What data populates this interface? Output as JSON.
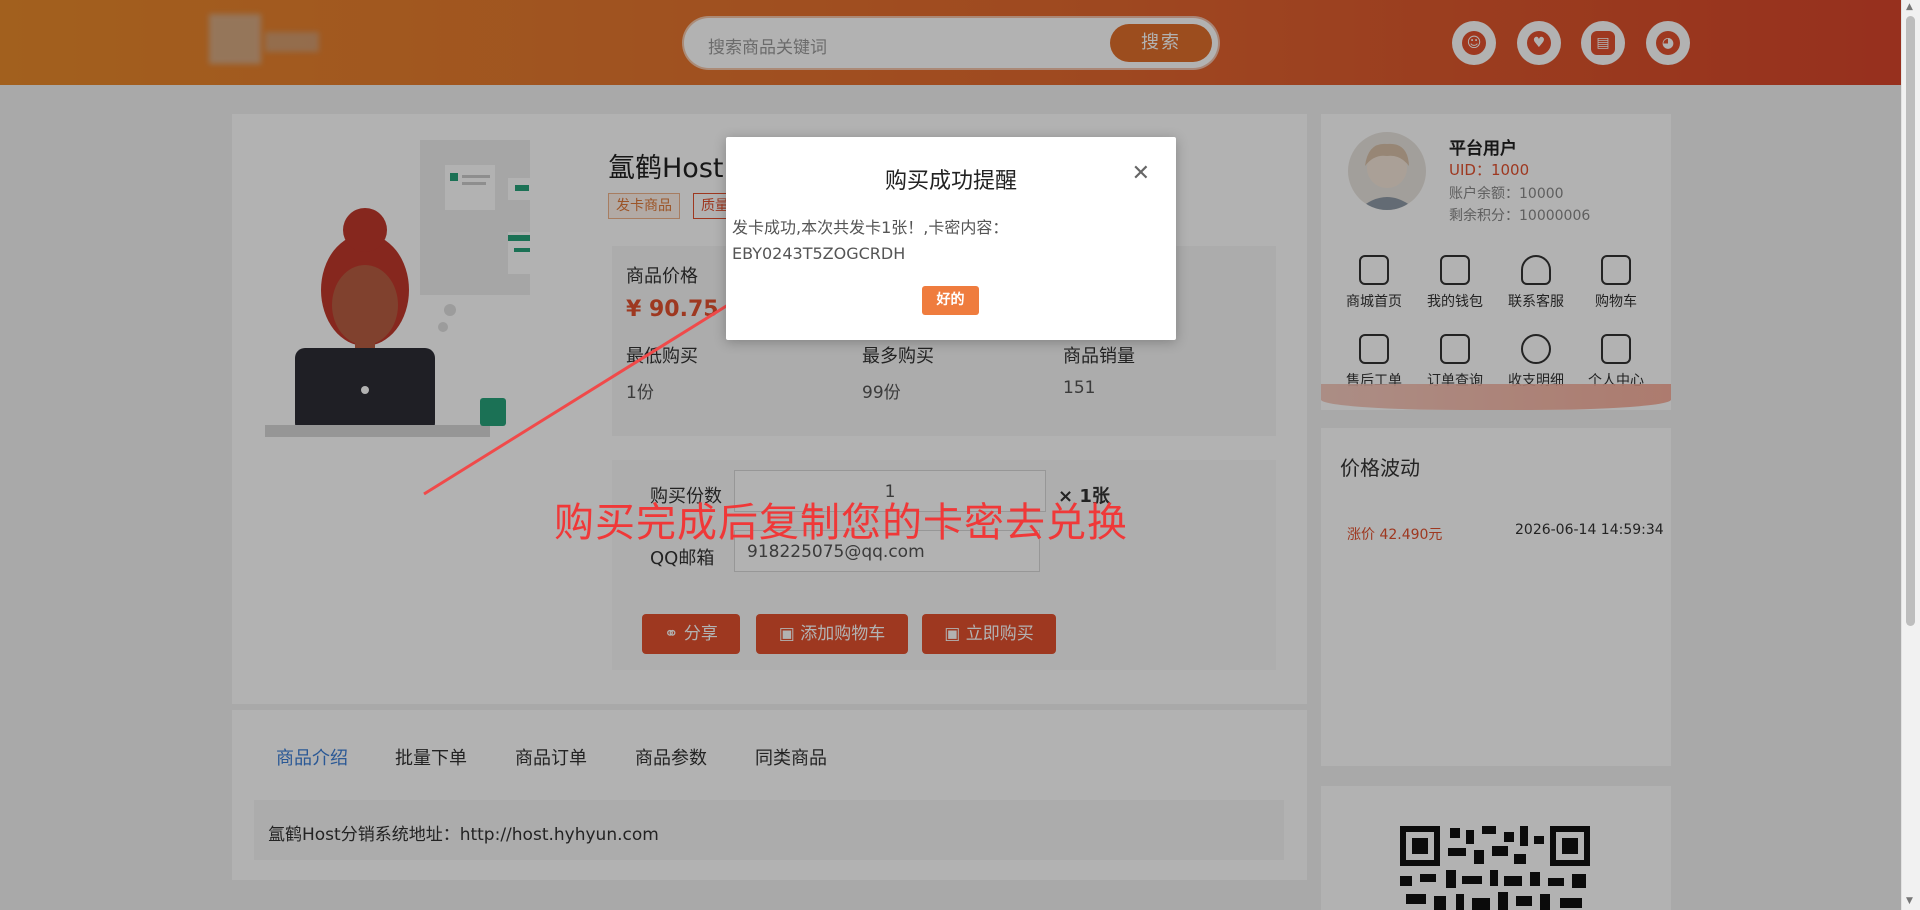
{
  "header": {
    "search_placeholder": "搜索商品关键词",
    "search_button": "搜索",
    "icons": [
      "smile-icon",
      "heart-icon",
      "message-icon",
      "user-icon"
    ]
  },
  "product": {
    "title": "氲鹤Host",
    "tags": [
      "发卡商品",
      "质量"
    ],
    "price_label": "商品价格",
    "price": "¥ 90.75",
    "min_buy_label": "最低购买",
    "min_buy": "1份",
    "max_buy_label": "最多购买",
    "max_buy": "99份",
    "sales_label": "商品销量",
    "sales": "151",
    "qty_label": "购买份数",
    "qty_value": "1",
    "unit": "× 1张",
    "email_label": "QQ邮箱",
    "email_value": "918225075@qq.com",
    "share_button": "分享",
    "cart_button": "添加购物车",
    "buy_button": "立即购买"
  },
  "tabs": [
    "商品介绍",
    "批量下单",
    "商品订单",
    "商品参数",
    "同类商品"
  ],
  "description": "氲鹤Host分销系统地址：http://host.hyhyun.com",
  "user": {
    "name": "平台用户",
    "uid": "UID：1000",
    "balance": "账户余额：10000",
    "points": "剩余积分：10000006",
    "menu": [
      "商城首页",
      "我的钱包",
      "联系客服",
      "购物车",
      "售后工单",
      "订单查询",
      "收支明细",
      "个人中心"
    ]
  },
  "price_trend": {
    "title": "价格波动",
    "change": "涨价 42.490元",
    "time": "2026-06-14 14:59:34"
  },
  "modal": {
    "title": "购买成功提醒",
    "line1": "发卡成功,本次共发卡1张！,卡密内容：",
    "line2": "EBY0243T5ZOGCRDH",
    "ok_button": "好的"
  },
  "annotation": "购买完成后复制您的卡密去兑换",
  "colors": {
    "accent": "#e2512f",
    "header_start": "#e98a2c",
    "header_end": "#d8452b",
    "link": "#3d7fd6"
  }
}
